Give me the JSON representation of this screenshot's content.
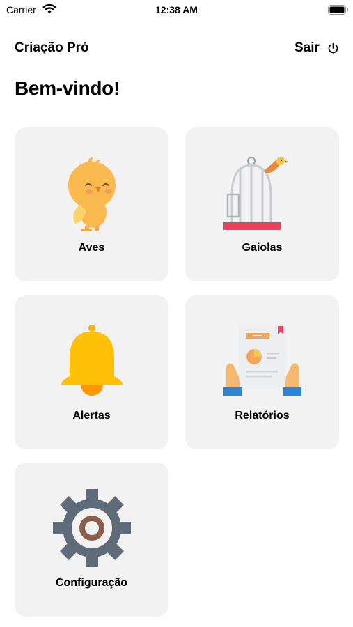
{
  "status_bar": {
    "carrier": "Carrier",
    "time": "12:38 AM",
    "icons": [
      "wifi-icon",
      "battery-icon"
    ]
  },
  "header": {
    "title": "Criação Pró",
    "logout_label": "Sair",
    "logout_icon": "power-icon"
  },
  "welcome": "Bem-vindo!",
  "menu": [
    {
      "label": "Aves",
      "icon": "bird-icon"
    },
    {
      "label": "Gaiolas",
      "icon": "birdcage-icon"
    },
    {
      "label": "Alertas",
      "icon": "bell-icon"
    },
    {
      "label": "Relatórios",
      "icon": "report-icon"
    },
    {
      "label": "Configuração",
      "icon": "gear-icon"
    }
  ],
  "colors": {
    "tile_background": "#f2f2f2",
    "bird_yellow": "#f9b94f",
    "bell_yellow": "#ffc107",
    "cage_red": "#e8415b",
    "gear_gray": "#5f6b78"
  }
}
